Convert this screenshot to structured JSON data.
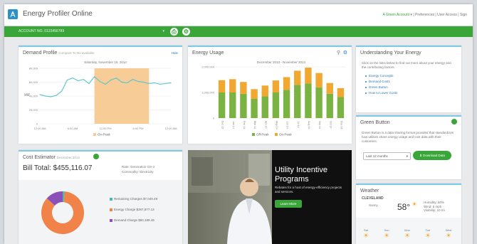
{
  "app": {
    "title": "Energy Profiler Online"
  },
  "header_links": {
    "account": "A Green Account",
    "preferences": "Preferences",
    "user_access": "User Access",
    "sign_out": "Sign"
  },
  "account_selector": {
    "value": "ACCOUNT NO. 0123456789"
  },
  "toolbar_icons": [
    "print-icon",
    "settings-icon"
  ],
  "demand_profile": {
    "title": "Demand Profile",
    "subtitle": "Compare To  No available",
    "link": "Hide",
    "chart_title": "Saturday, November 15, 2014",
    "ylabel": "kW",
    "legend_label": "On-Peak",
    "colors": {
      "line": "#5fc6cf",
      "onpeak": "#f7cc96"
    },
    "chart_data": {
      "type": "line",
      "x": [
        "12:00 AM",
        "2:00 AM",
        "4:00 AM",
        "6:00 AM",
        "8:00 AM",
        "10:00 AM",
        "12:00 PM",
        "2:00 PM",
        "4:00 PM",
        "6:00 PM",
        "8:00 PM",
        "10:00 PM",
        "12:00 AM"
      ],
      "values": [
        42,
        40,
        39,
        41,
        47,
        63,
        66,
        62,
        64,
        58,
        68,
        61,
        57,
        63,
        66,
        60,
        59,
        64,
        61,
        60,
        58,
        59,
        57,
        58,
        59
      ],
      "onpeak_range": [
        10,
        20
      ],
      "ylim": [
        0,
        80
      ],
      "yticks": [
        "0",
        "20,000",
        "40,000",
        "60,000",
        "80,000"
      ],
      "xticks": [
        "12:00 AM",
        "6:00 AM",
        "12:00 PM",
        "6:00 PM",
        "12:00 AM"
      ],
      "grid": true
    }
  },
  "energy_usage": {
    "title": "Energy Usage",
    "chart_title": "December 2013 - November 2014",
    "colors": {
      "offpeak": "#7bb342",
      "onpeak": "#f0a830"
    },
    "chart_data": {
      "type": "bar",
      "categories": [
        "Dec 13",
        "Jan 14",
        "Feb 14",
        "Mar 14",
        "Apr 14",
        "May 14",
        "Jun 14",
        "Jul 14",
        "Aug 14",
        "Sep 14",
        "Oct 14",
        "Nov 14"
      ],
      "series": [
        {
          "name": "Off-Peak",
          "values": [
            1000000,
            1000000,
            950000,
            750000,
            850000,
            1000000,
            1100000,
            1300000,
            1350000,
            1200000,
            950000,
            820000
          ]
        },
        {
          "name": "On-Peak",
          "values": [
            480000,
            520000,
            460000,
            380000,
            420000,
            470000,
            500000,
            550000,
            620000,
            560000,
            420000,
            350000
          ]
        }
      ],
      "ylim": [
        0,
        2000000
      ],
      "yticks": [
        "0",
        "1,000,000",
        "2,000,000"
      ],
      "legend": "bottom"
    }
  },
  "understanding": {
    "title": "Understanding Your Energy",
    "intro": "Click on the links below to find out more about your energy and the contributing factors.",
    "links": [
      "Energy Concepts",
      "Demand Costs",
      "Green Button",
      "How to Lower Costs"
    ]
  },
  "green_button": {
    "title": "Green Button",
    "text": "Green Button is a data sharing format provided that standardizes how utilities share energy usage and cost data with their customers.",
    "select_value": "Last 12 months",
    "download_label": "Download Data"
  },
  "cost_estimator": {
    "title": "Cost Estimator",
    "subtitle": "December 2014",
    "bill_total": "Bill Total: $455,116.07",
    "rate_label": "Rate: Generation GS-3",
    "commodity_label": "Commodity: Electricity",
    "slices": [
      {
        "label": "Remaining Charges",
        "value_text": "$7,049.49",
        "value": 7049.49,
        "color": "#4bb8a9"
      },
      {
        "label": "Energy Charge",
        "value_text": "$387,877.13",
        "value": 387877.13,
        "color": "#f0824a"
      },
      {
        "label": "Demand Charge",
        "value_text": "$60,189.45",
        "value": 60189.45,
        "color": "#8a4fb8"
      }
    ]
  },
  "promo": {
    "title_line1": "Utility Incentive",
    "title_line2": "Programs",
    "text": "Rebates for a host of energy-efficiency projects and services.",
    "button_label": "Learn More"
  },
  "weather": {
    "title": "Weather",
    "location": "CLEVELAND",
    "condition": "Sunny",
    "temperature": "58°",
    "details": [
      "Humidity: 60%",
      "Wind: 5 mph",
      "Visibility: 10 mi"
    ],
    "forecast": [
      {
        "day": "Sat",
        "icon": "sun-icon"
      },
      {
        "day": "Sun",
        "icon": "sun-icon"
      },
      {
        "day": "Mon",
        "icon": "sun-icon"
      },
      {
        "day": "Tue",
        "icon": "sun-icon"
      },
      {
        "day": "Wed",
        "icon": "sun-icon"
      }
    ]
  },
  "accent_colors": {
    "green": "#3aa63a",
    "panel_border": "#7ec8ea",
    "link": "#2a7bb8"
  }
}
